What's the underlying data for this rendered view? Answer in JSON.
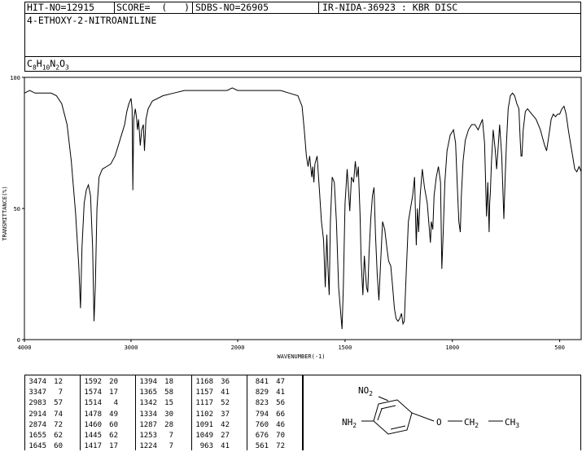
{
  "header": {
    "hit_no": "HIT-NO=12915",
    "score": "SCORE=  (   )",
    "sdbs_no": "SDBS-NO=26905",
    "ir_info": "IR-NIDA-36923 : KBR DISC",
    "compound_name": "4-ETHOXY-2-NITROANILINE",
    "formula": "C8H10N2O3",
    "formula_parts": [
      "C",
      "8",
      "H",
      "10",
      "N",
      "2",
      "O",
      "3"
    ]
  },
  "chart_data": {
    "type": "line",
    "xlabel": "WAVENUMBER(-1)",
    "ylabel": "TRANSMITTANCE(%)",
    "x_ticks": [
      "4000",
      "3000",
      "2000",
      "1500",
      "1000",
      "500"
    ],
    "y_ticks": [
      "100",
      "50",
      "0"
    ],
    "xlim": [
      4000,
      400
    ],
    "ylim": [
      0,
      100
    ],
    "grid": false,
    "series": [
      {
        "points": [
          [
            4000,
            94
          ],
          [
            3950,
            95
          ],
          [
            3900,
            94
          ],
          [
            3850,
            94
          ],
          [
            3800,
            94
          ],
          [
            3750,
            94
          ],
          [
            3700,
            93
          ],
          [
            3650,
            90
          ],
          [
            3600,
            82
          ],
          [
            3560,
            68
          ],
          [
            3520,
            48
          ],
          [
            3490,
            28
          ],
          [
            3474,
            12
          ],
          [
            3460,
            35
          ],
          [
            3440,
            52
          ],
          [
            3420,
            57
          ],
          [
            3400,
            59
          ],
          [
            3380,
            55
          ],
          [
            3360,
            35
          ],
          [
            3347,
            7
          ],
          [
            3335,
            20
          ],
          [
            3320,
            50
          ],
          [
            3300,
            62
          ],
          [
            3270,
            65
          ],
          [
            3230,
            66
          ],
          [
            3190,
            67
          ],
          [
            3150,
            70
          ],
          [
            3120,
            74
          ],
          [
            3090,
            78
          ],
          [
            3060,
            82
          ],
          [
            3040,
            87
          ],
          [
            3020,
            90
          ],
          [
            3000,
            92
          ],
          [
            2990,
            88
          ],
          [
            2983,
            57
          ],
          [
            2975,
            84
          ],
          [
            2960,
            88
          ],
          [
            2950,
            85
          ],
          [
            2940,
            80
          ],
          [
            2930,
            84
          ],
          [
            2914,
            74
          ],
          [
            2900,
            80
          ],
          [
            2885,
            82
          ],
          [
            2874,
            72
          ],
          [
            2860,
            84
          ],
          [
            2840,
            88
          ],
          [
            2800,
            91
          ],
          [
            2700,
            93
          ],
          [
            2600,
            94
          ],
          [
            2500,
            95
          ],
          [
            2400,
            95
          ],
          [
            2300,
            95
          ],
          [
            2200,
            95
          ],
          [
            2100,
            95
          ],
          [
            2050,
            96
          ],
          [
            2000,
            95
          ],
          [
            1950,
            95
          ],
          [
            1900,
            95
          ],
          [
            1850,
            95
          ],
          [
            1800,
            95
          ],
          [
            1760,
            94
          ],
          [
            1720,
            93
          ],
          [
            1700,
            89
          ],
          [
            1690,
            80
          ],
          [
            1680,
            70
          ],
          [
            1672,
            66
          ],
          [
            1665,
            70
          ],
          [
            1655,
            62
          ],
          [
            1650,
            66
          ],
          [
            1645,
            60
          ],
          [
            1640,
            67
          ],
          [
            1630,
            70
          ],
          [
            1620,
            58
          ],
          [
            1610,
            45
          ],
          [
            1600,
            38
          ],
          [
            1592,
            20
          ],
          [
            1585,
            40
          ],
          [
            1580,
            28
          ],
          [
            1574,
            17
          ],
          [
            1568,
            45
          ],
          [
            1560,
            62
          ],
          [
            1550,
            60
          ],
          [
            1540,
            45
          ],
          [
            1530,
            20
          ],
          [
            1520,
            10
          ],
          [
            1514,
            4
          ],
          [
            1508,
            20
          ],
          [
            1500,
            52
          ],
          [
            1490,
            65
          ],
          [
            1478,
            49
          ],
          [
            1470,
            62
          ],
          [
            1460,
            60
          ],
          [
            1452,
            68
          ],
          [
            1445,
            62
          ],
          [
            1438,
            66
          ],
          [
            1430,
            48
          ],
          [
            1425,
            30
          ],
          [
            1417,
            17
          ],
          [
            1410,
            32
          ],
          [
            1405,
            26
          ],
          [
            1400,
            20
          ],
          [
            1394,
            18
          ],
          [
            1388,
            33
          ],
          [
            1380,
            46
          ],
          [
            1372,
            55
          ],
          [
            1365,
            58
          ],
          [
            1358,
            40
          ],
          [
            1350,
            25
          ],
          [
            1342,
            15
          ],
          [
            1334,
            30
          ],
          [
            1325,
            45
          ],
          [
            1315,
            42
          ],
          [
            1305,
            35
          ],
          [
            1297,
            30
          ],
          [
            1287,
            28
          ],
          [
            1278,
            20
          ],
          [
            1270,
            12
          ],
          [
            1262,
            8
          ],
          [
            1253,
            7
          ],
          [
            1245,
            8
          ],
          [
            1237,
            10
          ],
          [
            1230,
            6
          ],
          [
            1224,
            7
          ],
          [
            1215,
            25
          ],
          [
            1205,
            45
          ],
          [
            1195,
            50
          ],
          [
            1185,
            55
          ],
          [
            1176,
            62
          ],
          [
            1168,
            36
          ],
          [
            1163,
            50
          ],
          [
            1157,
            41
          ],
          [
            1150,
            55
          ],
          [
            1140,
            65
          ],
          [
            1130,
            58
          ],
          [
            1117,
            52
          ],
          [
            1110,
            45
          ],
          [
            1102,
            37
          ],
          [
            1098,
            45
          ],
          [
            1091,
            42
          ],
          [
            1085,
            55
          ],
          [
            1075,
            62
          ],
          [
            1065,
            66
          ],
          [
            1055,
            60
          ],
          [
            1049,
            27
          ],
          [
            1043,
            40
          ],
          [
            1035,
            60
          ],
          [
            1025,
            72
          ],
          [
            1010,
            78
          ],
          [
            995,
            80
          ],
          [
            985,
            75
          ],
          [
            975,
            55
          ],
          [
            970,
            45
          ],
          [
            963,
            41
          ],
          [
            958,
            55
          ],
          [
            950,
            68
          ],
          [
            940,
            76
          ],
          [
            925,
            80
          ],
          [
            910,
            82
          ],
          [
            895,
            82
          ],
          [
            880,
            80
          ],
          [
            870,
            82
          ],
          [
            860,
            84
          ],
          [
            850,
            75
          ],
          [
            845,
            60
          ],
          [
            841,
            47
          ],
          [
            835,
            60
          ],
          [
            829,
            41
          ],
          [
            826,
            52
          ],
          [
            823,
            56
          ],
          [
            818,
            68
          ],
          [
            810,
            80
          ],
          [
            800,
            72
          ],
          [
            794,
            65
          ],
          [
            788,
            72
          ],
          [
            780,
            82
          ],
          [
            770,
            70
          ],
          [
            760,
            46
          ],
          [
            755,
            60
          ],
          [
            748,
            75
          ],
          [
            740,
            88
          ],
          [
            730,
            93
          ],
          [
            720,
            94
          ],
          [
            710,
            93
          ],
          [
            700,
            90
          ],
          [
            690,
            88
          ],
          [
            684,
            76
          ],
          [
            680,
            70
          ],
          [
            676,
            70
          ],
          [
            670,
            80
          ],
          [
            660,
            87
          ],
          [
            650,
            88
          ],
          [
            640,
            87
          ],
          [
            630,
            86
          ],
          [
            620,
            85
          ],
          [
            610,
            84
          ],
          [
            600,
            82
          ],
          [
            590,
            80
          ],
          [
            580,
            77
          ],
          [
            570,
            74
          ],
          [
            561,
            72
          ],
          [
            550,
            78
          ],
          [
            540,
            84
          ],
          [
            530,
            86
          ],
          [
            520,
            85
          ],
          [
            510,
            86
          ],
          [
            500,
            86
          ],
          [
            490,
            88
          ],
          [
            480,
            89
          ],
          [
            470,
            86
          ],
          [
            460,
            80
          ],
          [
            450,
            75
          ],
          [
            440,
            70
          ],
          [
            430,
            65
          ],
          [
            420,
            64
          ],
          [
            410,
            66
          ],
          [
            400,
            64
          ]
        ]
      }
    ]
  },
  "peak_table": {
    "columns": [
      [
        [
          "3474",
          "12"
        ],
        [
          "3347",
          "7"
        ],
        [
          "2983",
          "57"
        ],
        [
          "2914",
          "74"
        ],
        [
          "2874",
          "72"
        ],
        [
          "1655",
          "62"
        ],
        [
          "1645",
          "60"
        ]
      ],
      [
        [
          "1592",
          "20"
        ],
        [
          "1574",
          "17"
        ],
        [
          "1514",
          "4"
        ],
        [
          "1478",
          "49"
        ],
        [
          "1460",
          "60"
        ],
        [
          "1445",
          "62"
        ],
        [
          "1417",
          "17"
        ]
      ],
      [
        [
          "1394",
          "18"
        ],
        [
          "1365",
          "58"
        ],
        [
          "1342",
          "15"
        ],
        [
          "1334",
          "30"
        ],
        [
          "1287",
          "28"
        ],
        [
          "1253",
          "7"
        ],
        [
          "1224",
          "7"
        ]
      ],
      [
        [
          "1168",
          "36"
        ],
        [
          "1157",
          "41"
        ],
        [
          "1117",
          "52"
        ],
        [
          "1102",
          "37"
        ],
        [
          "1091",
          "42"
        ],
        [
          "1049",
          "27"
        ],
        [
          "963",
          "41"
        ]
      ],
      [
        [
          "841",
          "47"
        ],
        [
          "829",
          "41"
        ],
        [
          "823",
          "56"
        ],
        [
          "794",
          "66"
        ],
        [
          "760",
          "46"
        ],
        [
          "676",
          "70"
        ],
        [
          "561",
          "72"
        ]
      ]
    ]
  },
  "structure": {
    "no2_label": "NO",
    "no2_sub": "2",
    "nh2_label": "NH",
    "nh2_sub": "2",
    "o_label": "O",
    "ch2_label": "CH",
    "ch2_sub": "2",
    "ch3_label": "CH",
    "ch3_sub": "3"
  }
}
